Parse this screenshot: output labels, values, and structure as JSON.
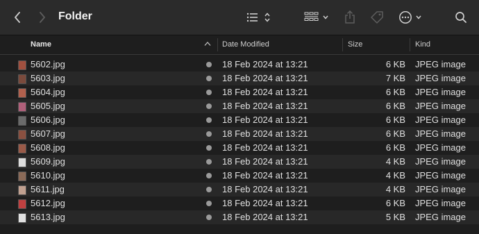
{
  "window": {
    "title": "Folder"
  },
  "toolbar": {
    "back_icon": "chevron-left-icon",
    "forward_icon": "chevron-right-icon",
    "view_icon": "list-view-icon",
    "group_icon": "group-grid-icon",
    "share_icon": "share-icon",
    "tag_icon": "tag-icon",
    "more_icon": "ellipsis-circle-icon",
    "search_icon": "search-icon"
  },
  "columns": {
    "name": "Name",
    "date": "Date Modified",
    "size": "Size",
    "kind": "Kind"
  },
  "files": [
    {
      "name": "5602.jpg",
      "date": "18 Feb 2024 at 13:21",
      "size": "6 KB",
      "kind": "JPEG image",
      "thumb_color": "#a0503f"
    },
    {
      "name": "5603.jpg",
      "date": "18 Feb 2024 at 13:21",
      "size": "7 KB",
      "kind": "JPEG image",
      "thumb_color": "#7a4a3c"
    },
    {
      "name": "5604.jpg",
      "date": "18 Feb 2024 at 13:21",
      "size": "6 KB",
      "kind": "JPEG image",
      "thumb_color": "#b0604d"
    },
    {
      "name": "5605.jpg",
      "date": "18 Feb 2024 at 13:21",
      "size": "6 KB",
      "kind": "JPEG image",
      "thumb_color": "#b0607a"
    },
    {
      "name": "5606.jpg",
      "date": "18 Feb 2024 at 13:21",
      "size": "6 KB",
      "kind": "JPEG image",
      "thumb_color": "#6a6a6a"
    },
    {
      "name": "5607.jpg",
      "date": "18 Feb 2024 at 13:21",
      "size": "6 KB",
      "kind": "JPEG image",
      "thumb_color": "#8a5040"
    },
    {
      "name": "5608.jpg",
      "date": "18 Feb 2024 at 13:21",
      "size": "6 KB",
      "kind": "JPEG image",
      "thumb_color": "#9a5a48"
    },
    {
      "name": "5609.jpg",
      "date": "18 Feb 2024 at 13:21",
      "size": "4 KB",
      "kind": "JPEG image",
      "thumb_color": "#dcdcdc"
    },
    {
      "name": "5610.jpg",
      "date": "18 Feb 2024 at 13:21",
      "size": "4 KB",
      "kind": "JPEG image",
      "thumb_color": "#8a6a58"
    },
    {
      "name": "5611.jpg",
      "date": "18 Feb 2024 at 13:21",
      "size": "4 KB",
      "kind": "JPEG image",
      "thumb_color": "#c0a090"
    },
    {
      "name": "5612.jpg",
      "date": "18 Feb 2024 at 13:21",
      "size": "6 KB",
      "kind": "JPEG image",
      "thumb_color": "#c04040"
    },
    {
      "name": "5613.jpg",
      "date": "18 Feb 2024 at 13:21",
      "size": "5 KB",
      "kind": "JPEG image",
      "thumb_color": "#e0e0e0"
    }
  ]
}
